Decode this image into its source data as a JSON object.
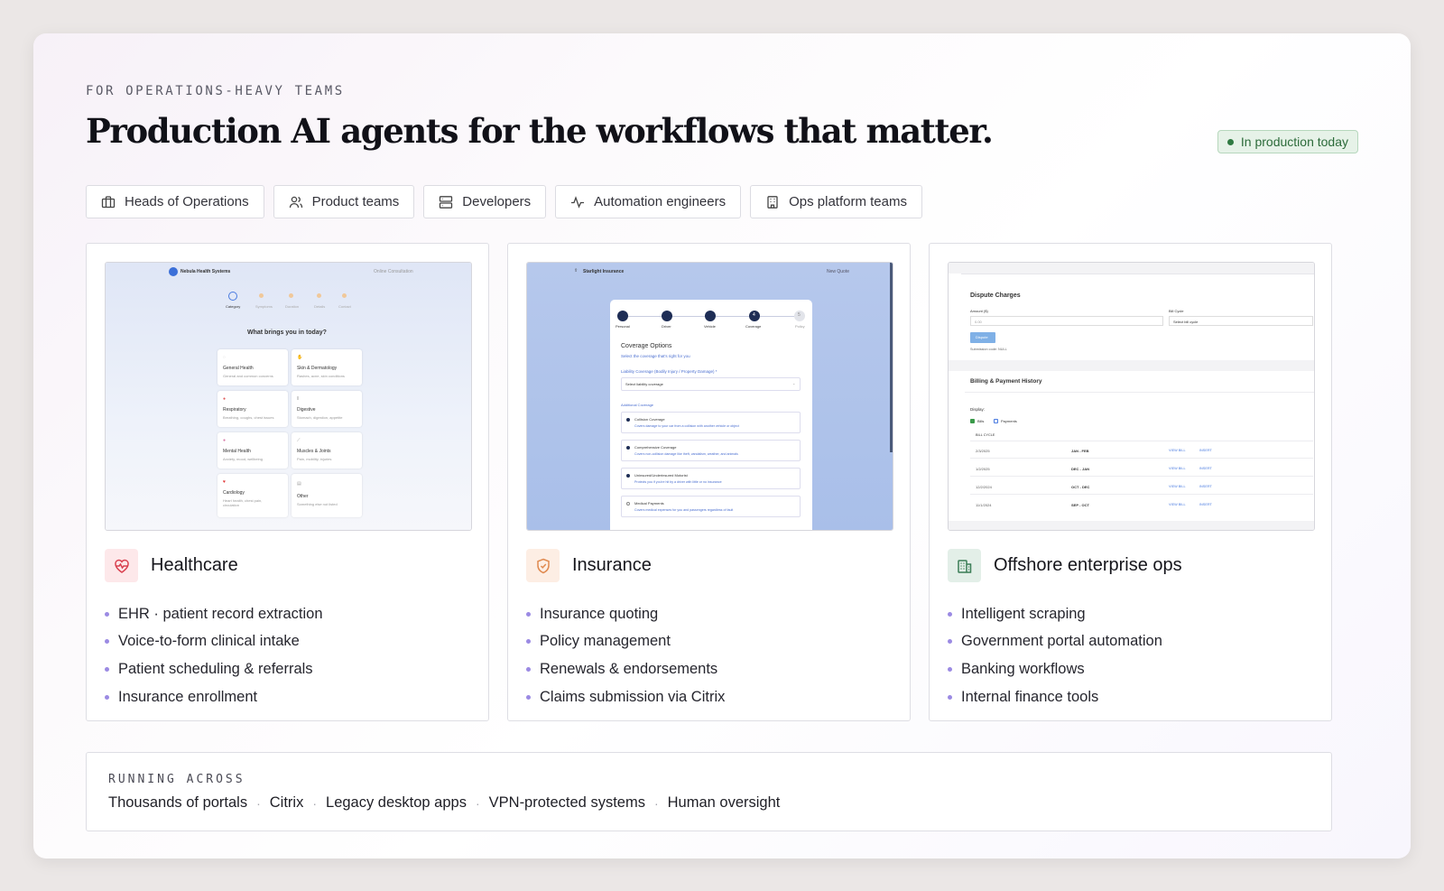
{
  "header": {
    "eyebrow": "FOR OPERATIONS-HEAVY TEAMS",
    "headline": "Production AI agents for the workflows that matter.",
    "badge": "In production today"
  },
  "audiences": [
    {
      "label": "Heads of Operations",
      "icon": "briefcase-icon"
    },
    {
      "label": "Product teams",
      "icon": "users-icon"
    },
    {
      "label": "Developers",
      "icon": "server-icon"
    },
    {
      "label": "Automation engineers",
      "icon": "activity-icon"
    },
    {
      "label": "Ops platform teams",
      "icon": "building-icon"
    }
  ],
  "cards": [
    {
      "title": "Healthcare",
      "icon": "heart-pulse-icon",
      "bullets": [
        "EHR · patient record extraction",
        "Voice-to-form clinical intake",
        "Patient scheduling & referrals",
        "Insurance enrollment"
      ],
      "preview": {
        "brand": "Nebula Health Systems",
        "nav_right": "Online Consultation",
        "steps": [
          "Category",
          "Symptoms",
          "Duration",
          "Details",
          "Contact"
        ],
        "question": "What brings you in today?",
        "tiles": [
          {
            "title": "General Health",
            "sub": "General and common concerns"
          },
          {
            "title": "Skin & Dermatology",
            "sub": "Rashes, acne, skin conditions"
          },
          {
            "title": "Respiratory",
            "sub": "Breathing, coughs, chest issues"
          },
          {
            "title": "Digestive",
            "sub": "Stomach, digestion, appetite"
          },
          {
            "title": "Mental Health",
            "sub": "Anxiety, mood, wellbeing"
          },
          {
            "title": "Muscles & Joints",
            "sub": "Pain, mobility, injuries"
          },
          {
            "title": "Cardiology",
            "sub": "Heart health, chest pain, circulation"
          },
          {
            "title": "Other",
            "sub": "Something else not listed"
          }
        ]
      }
    },
    {
      "title": "Insurance",
      "icon": "shield-check-icon",
      "bullets": [
        "Insurance quoting",
        "Policy management",
        "Renewals & endorsements",
        "Claims submission via Citrix"
      ],
      "preview": {
        "brand": "Starlight Insurance",
        "nav_right": "New Quote",
        "steps": [
          "Personal",
          "Driver",
          "Vehicle",
          "Coverage",
          "Policy"
        ],
        "step_current": "4",
        "step_last": "5",
        "form_title": "Coverage Options",
        "form_sub": "Select the coverage that's right for you",
        "liability_label": "Liability Coverage (Bodily Injury / Property Damage) *",
        "liability_placeholder": "Select liability coverage",
        "additional_label": "Additional Coverage",
        "options": [
          {
            "title": "Collision Coverage",
            "sub": "Covers damage to your car from a collision with another vehicle or object"
          },
          {
            "title": "Comprehensive Coverage",
            "sub": "Covers non-collision damage like theft, vandalism, weather, and animals"
          },
          {
            "title": "Uninsured/Underinsured Motorist",
            "sub": "Protects you if you're hit by a driver with little or no insurance"
          },
          {
            "title": "Medical Payments",
            "sub": "Covers medical expenses for you and passengers regardless of fault"
          }
        ]
      }
    },
    {
      "title": "Offshore enterprise ops",
      "icon": "office-building-icon",
      "bullets": [
        "Intelligent scraping",
        "Government portal automation",
        "Banking workflows",
        "Internal finance tools"
      ],
      "preview": {
        "dispute_title": "Dispute Charges",
        "amount_label": "Amount ($)",
        "amount_value": "0.00",
        "cycle_label": "Bill Cycle",
        "cycle_placeholder": "Select bill cycle",
        "dispute_button": "Dispute",
        "submission_code": "Submission code: NULL",
        "history_title": "Billing & Payment History",
        "display_label": "Display:",
        "filter_bills": "Bills",
        "filter_payments": "Payments",
        "column_header": "BILL CYCLE",
        "view_bill": "VIEW BILL",
        "insert": "INSERT",
        "rows": [
          {
            "date": "2/3/2025",
            "cycle": "JAN - FEB"
          },
          {
            "date": "1/2/2025",
            "cycle": "DEC - JAN"
          },
          {
            "date": "12/2/2024",
            "cycle": "OCT - DEC"
          },
          {
            "date": "11/1/2024",
            "cycle": "SEP - OCT"
          }
        ]
      }
    }
  ],
  "running": {
    "label": "RUNNING ACROSS",
    "items": [
      "Thousands of portals",
      "Citrix",
      "Legacy desktop apps",
      "VPN-protected systems",
      "Human oversight"
    ]
  },
  "colors": {
    "accent_bullet": "#9b8ae3",
    "badge_green": "#2f7a42",
    "healthcare_icon_bg": "#fde8ea",
    "insurance_icon_bg": "#fdeee4",
    "offshore_icon_bg": "#e3efe8"
  }
}
